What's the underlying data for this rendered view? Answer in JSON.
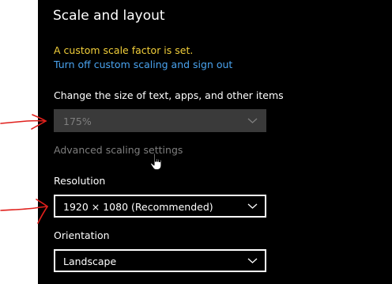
{
  "scale_layout": {
    "title": "Scale and layout",
    "custom_scale_warning": "A custom scale factor is set.",
    "turn_off_link": "Turn off custom scaling and sign out",
    "size_label": "Change the size of text, apps, and other items",
    "scale_value": "175%",
    "advanced_link": "Advanced scaling settings",
    "resolution_label": "Resolution",
    "resolution_value": "1920 × 1080 (Recommended)",
    "orientation_label": "Orientation",
    "orientation_value": "Landscape"
  },
  "colors": {
    "warning": "#f2cf3a",
    "link": "#4aa3ef",
    "annotation_arrows": "#e0201c"
  },
  "icons": {
    "dropdown": "chevron-down-icon",
    "cursor": "hand-pointer-icon",
    "annotation": "red-arrow-annotation"
  }
}
